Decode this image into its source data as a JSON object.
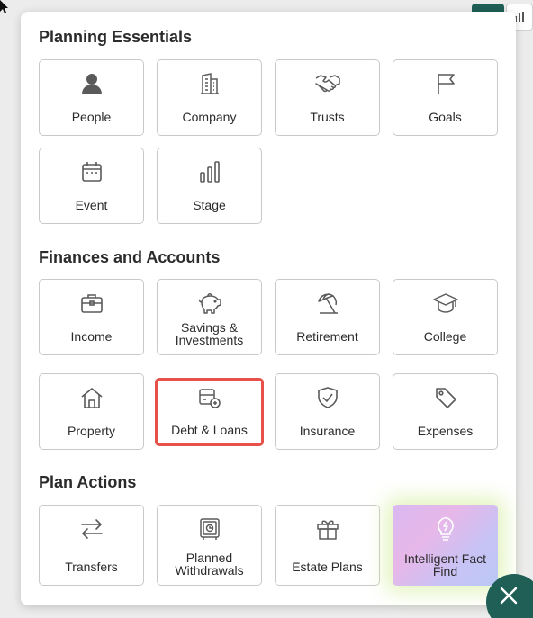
{
  "sections": [
    {
      "title": "Planning Essentials",
      "tiles": [
        {
          "label": "People",
          "icon": "person-icon"
        },
        {
          "label": "Company",
          "icon": "building-icon"
        },
        {
          "label": "Trusts",
          "icon": "handshake-icon"
        },
        {
          "label": "Goals",
          "icon": "flag-icon"
        },
        {
          "label": "Event",
          "icon": "calendar-icon"
        },
        {
          "label": "Stage",
          "icon": "bar-chart-icon"
        }
      ]
    },
    {
      "title": "Finances and Accounts",
      "tiles": [
        {
          "label": "Income",
          "icon": "briefcase-icon"
        },
        {
          "label": "Savings & Investments",
          "icon": "piggy-bank-icon"
        },
        {
          "label": "Retirement",
          "icon": "beach-umbrella-icon"
        },
        {
          "label": "College",
          "icon": "graduation-cap-icon"
        },
        {
          "label": "Property",
          "icon": "house-icon"
        },
        {
          "label": "Debt & Loans",
          "icon": "debt-card-icon"
        },
        {
          "label": "Insurance",
          "icon": "shield-check-icon"
        },
        {
          "label": "Expenses",
          "icon": "price-tag-icon"
        }
      ]
    },
    {
      "title": "Plan Actions",
      "tiles": [
        {
          "label": "Transfers",
          "icon": "transfer-arrows-icon"
        },
        {
          "label": "Planned Withdrawals",
          "icon": "safe-icon"
        },
        {
          "label": "Estate Plans",
          "icon": "gift-icon"
        },
        {
          "label": "Intelligent Fact Find",
          "icon": "lightbulb-icon"
        }
      ]
    }
  ],
  "colors": {
    "accent": "#1f5f56",
    "highlight_border": "#e8504a",
    "tile_border": "#c9c9c9",
    "icon": "#5a5a5a"
  }
}
